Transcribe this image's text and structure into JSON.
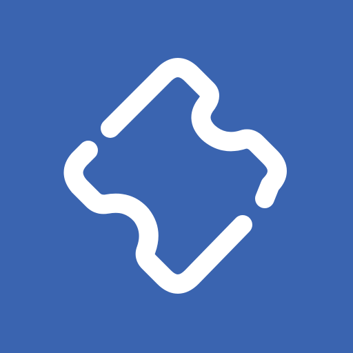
{
  "icon": {
    "name": "ticket-icon",
    "colors": {
      "background": "#3A64B0",
      "glyph": "#FFFFFF"
    }
  }
}
